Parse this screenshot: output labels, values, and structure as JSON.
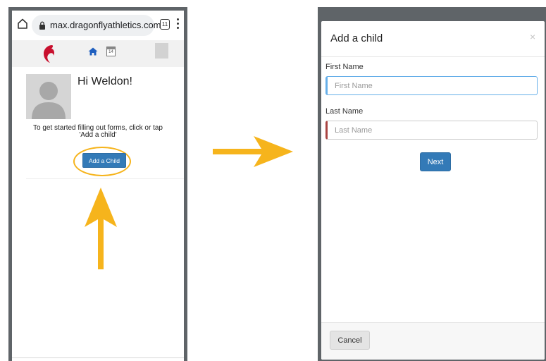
{
  "browser": {
    "url": "max.dragonflyathletics.com",
    "tab_count": "11",
    "icons": [
      "home-icon",
      "lock-icon",
      "tabs-icon",
      "menu-icon"
    ]
  },
  "site_nav": {
    "icons": [
      "logo-icon",
      "home-icon",
      "calendar-icon",
      "avatar-icon"
    ],
    "calendar_day": "14"
  },
  "dashboard": {
    "greeting": "Hi Weldon!",
    "intro_line1": "To get started filling out forms, click or tap",
    "intro_line2": "'Add a child'",
    "add_child_button": "Add a Child"
  },
  "modal": {
    "title": "Add a child",
    "close_symbol": "×",
    "first_name_label": "First Name",
    "first_name_placeholder": "First Name",
    "first_name_value": "",
    "last_name_label": "Last Name",
    "last_name_placeholder": "Last Name",
    "last_name_value": "",
    "next_button": "Next",
    "cancel_button": "Cancel"
  },
  "colors": {
    "highlight_arrow": "#f6b41c",
    "primary_button": "#337ab7",
    "focus_border": "#66afe9",
    "error_border": "#a94442",
    "phone_frame": "#5f6468"
  }
}
